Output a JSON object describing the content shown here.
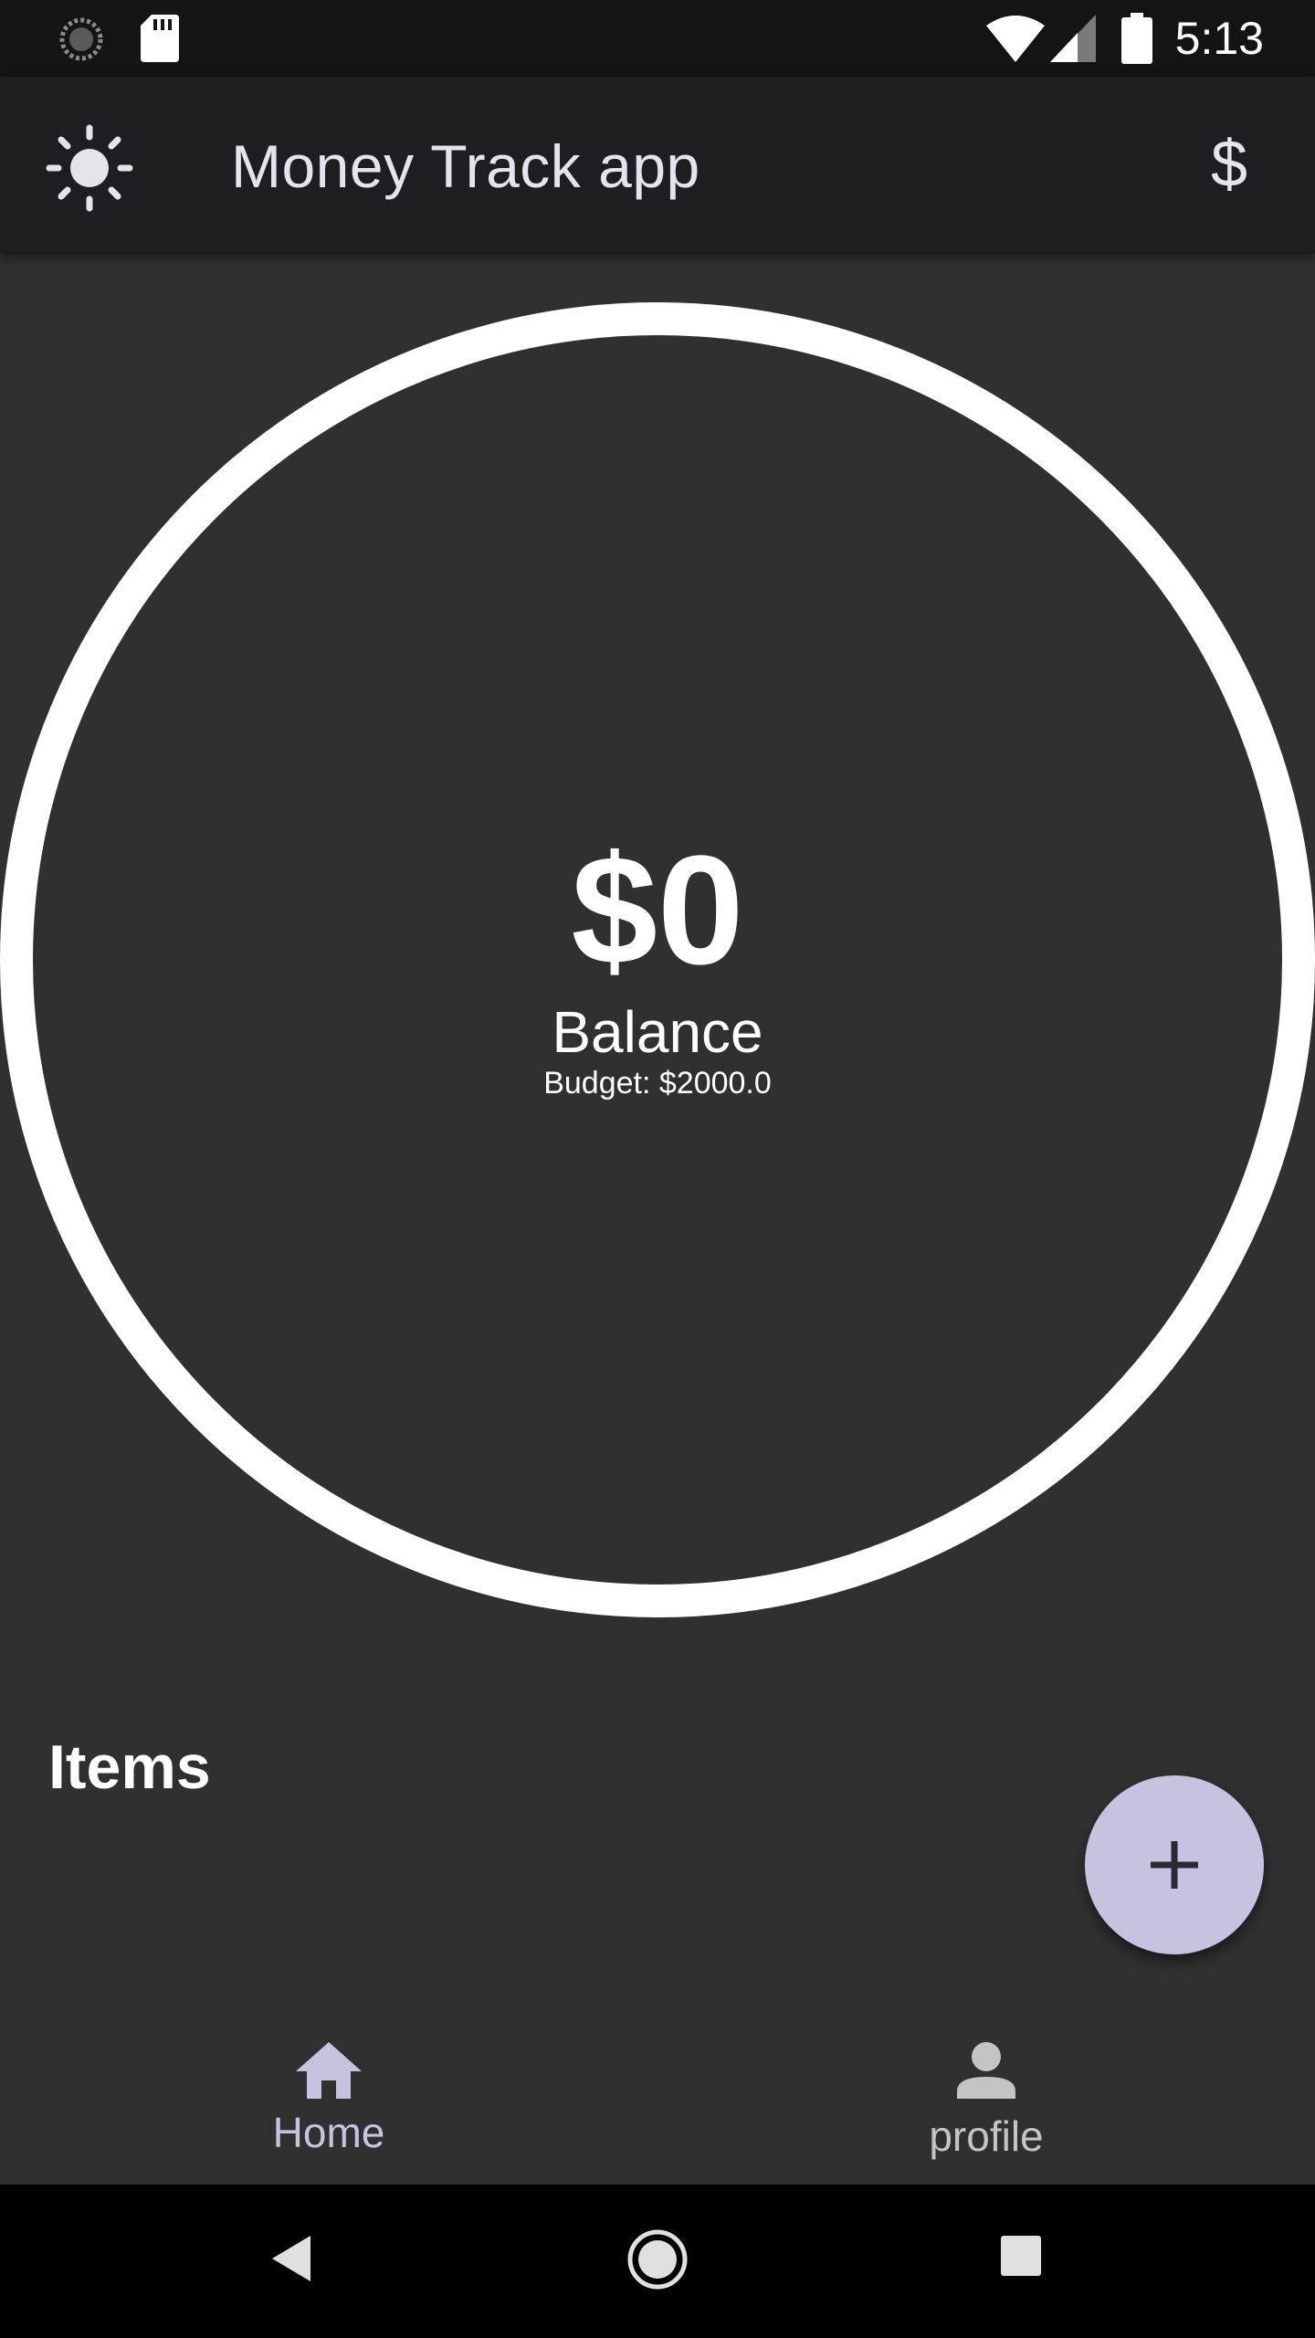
{
  "status_bar": {
    "time": "5:13",
    "icons": [
      "loading-spinner-icon",
      "sd-card-icon",
      "wifi-icon",
      "cell-signal-icon",
      "battery-icon"
    ]
  },
  "app_bar": {
    "title": "Money Track app",
    "theme_icon": "sun-icon",
    "currency_symbol": "$"
  },
  "balance": {
    "amount": "$0",
    "label": "Balance",
    "budget": "Budget: $2000.0"
  },
  "items": {
    "heading": "Items"
  },
  "fab": {
    "icon": "plus-icon"
  },
  "bottom_nav": {
    "items": [
      {
        "label": "Home",
        "icon": "home-icon",
        "selected": true
      },
      {
        "label": "profile",
        "icon": "person-icon",
        "selected": false
      }
    ]
  },
  "system_nav": {
    "buttons": [
      "back-icon",
      "home-circle-icon",
      "recents-square-icon"
    ]
  },
  "colors": {
    "background": "#303030",
    "app_bar": "#1e1e20",
    "accent": "#c5c3df",
    "ring": "#ffffff"
  }
}
